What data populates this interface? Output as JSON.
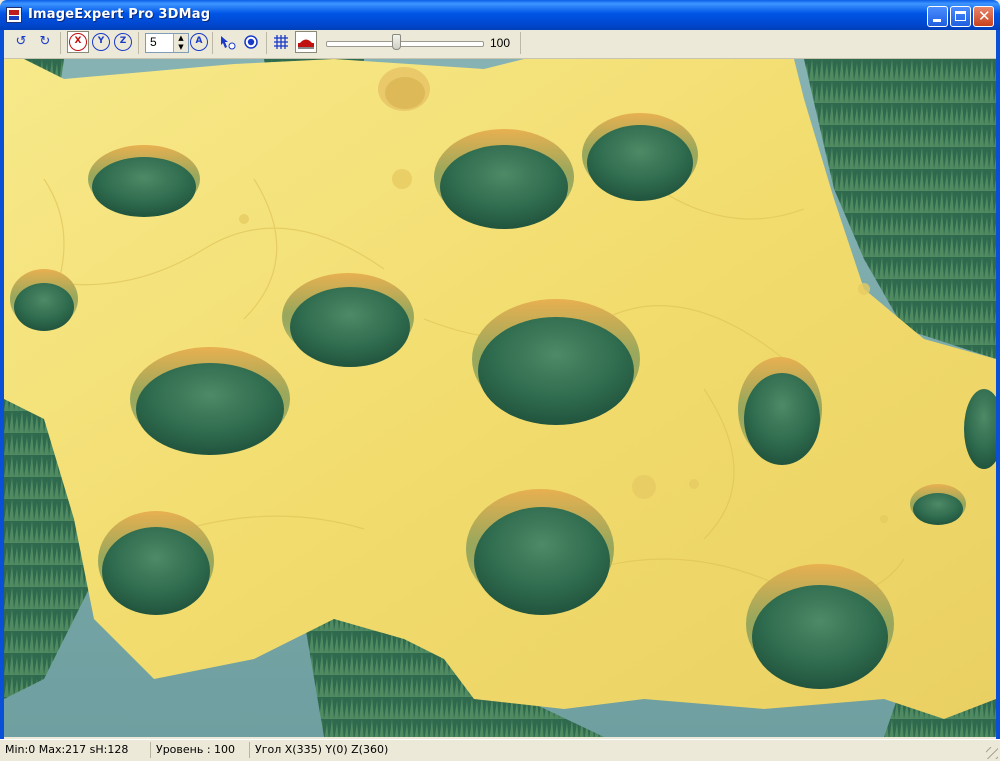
{
  "window": {
    "title": "ImageExpert Pro 3DMag",
    "icon": "app-icon"
  },
  "toolbar": {
    "rotate_left_icon": "rotate-ccw-icon",
    "rotate_right_icon": "rotate-cw-icon",
    "axis_x_label": "X",
    "axis_y_label": "Y",
    "axis_z_label": "Z",
    "step_value": "5",
    "auto_label": "A",
    "grid_icon": "grid-icon",
    "render_icon": "render-mode-icon",
    "slider_value": "100",
    "slider_level": 0.45
  },
  "status": {
    "range": "Min:0 Max:217 sH:128",
    "level": "Уровень : 100",
    "angle": "Угол X(335) Y(0) Z(360)"
  },
  "colors": {
    "surface": "#F4E27A",
    "pits": "#2F6A4E",
    "background": "#7AA9AB",
    "accent": "#1a3ac8"
  }
}
